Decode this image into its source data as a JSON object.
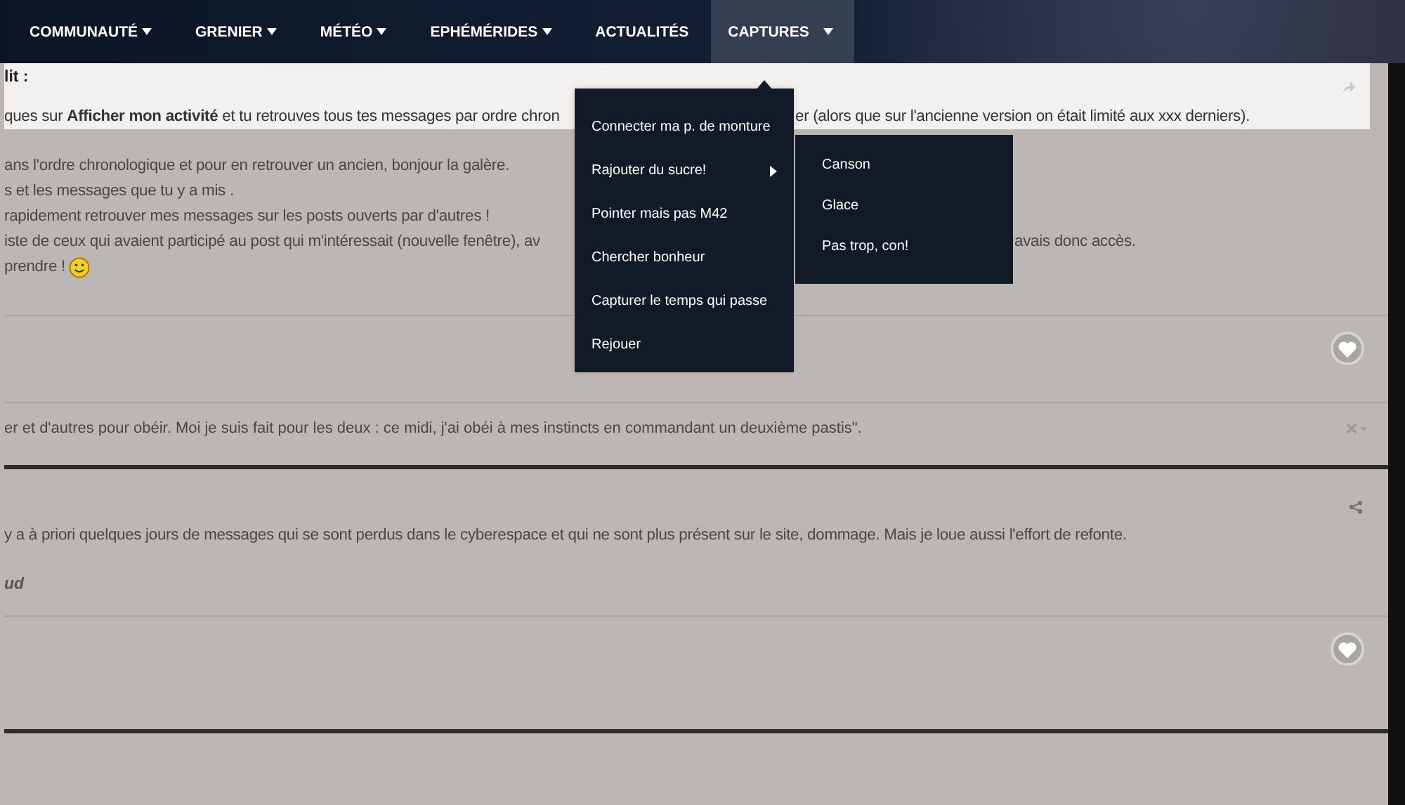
{
  "nav": {
    "items": [
      {
        "label": "COMMUNAUTÉ",
        "dropdown": true,
        "selected": false
      },
      {
        "label": "GRENIER",
        "dropdown": true,
        "selected": false
      },
      {
        "label": "MÉTÉO",
        "dropdown": true,
        "selected": false
      },
      {
        "label": "EPHÉMÉRIDES",
        "dropdown": true,
        "selected": false
      },
      {
        "label": "ACTUALITÉS",
        "dropdown": false,
        "selected": false
      },
      {
        "label": "CAPTURES",
        "dropdown": true,
        "selected": true
      }
    ]
  },
  "menu": {
    "items": [
      {
        "label": "Connecter ma p. de monture",
        "has_submenu": false
      },
      {
        "label": "Rajouter du sucre!",
        "has_submenu": true
      },
      {
        "label": "Pointer mais pas M42",
        "has_submenu": false
      },
      {
        "label": "Chercher bonheur",
        "has_submenu": false
      },
      {
        "label": "Capturer le temps qui passe",
        "has_submenu": false
      },
      {
        "label": "Rejouer",
        "has_submenu": false
      }
    ],
    "submenu": {
      "items": [
        {
          "label": "Canson"
        },
        {
          "label": "Glace"
        },
        {
          "label": "Pas trop, con!"
        }
      ]
    }
  },
  "posts": [
    {
      "quote": {
        "title": "lit :",
        "lines": [
          {
            "fragments": [
              "ques sur **Afficher mon activité** et tu retrouves tous tes messages par ordre chron",
              "er (alors que sur l'ancienne version on était limité aux xxx derniers)."
            ]
          }
        ]
      },
      "lines": [
        {
          "fragments": [
            "ans l'ordre chronologique et pour en retrouver un ancien, bonjour la galère."
          ],
          "smiley": false
        },
        {
          "fragments": [
            "s et les messages que tu y a mis ."
          ],
          "smiley": false
        },
        {
          "fragments": [
            "rapidement retrouver mes messages sur les posts ouverts par d'autres !"
          ],
          "smiley": false
        },
        {
          "fragments": [
            "iste de ceux qui avaient participé au post qui m'intéressait (nouvelle fenêtre), av",
            "avais donc accès."
          ],
          "smiley": false
        },
        {
          "fragments": [
            "prendre !"
          ],
          "smiley": true
        }
      ],
      "signature": "er et d'autres pour obéir. Moi je suis fait pour les deux : ce midi, j'ai obéi à mes instincts en commandant un deuxième pastis\"."
    },
    {
      "lines": [
        {
          "fragments": [
            "y a à priori quelques jours de messages qui se sont perdus dans le cyberespace et qui ne sont plus présent sur le site, dommage. Mais je loue aussi l'effort de refonte."
          ],
          "smiley": false
        }
      ],
      "author_note": "ud"
    }
  ]
}
